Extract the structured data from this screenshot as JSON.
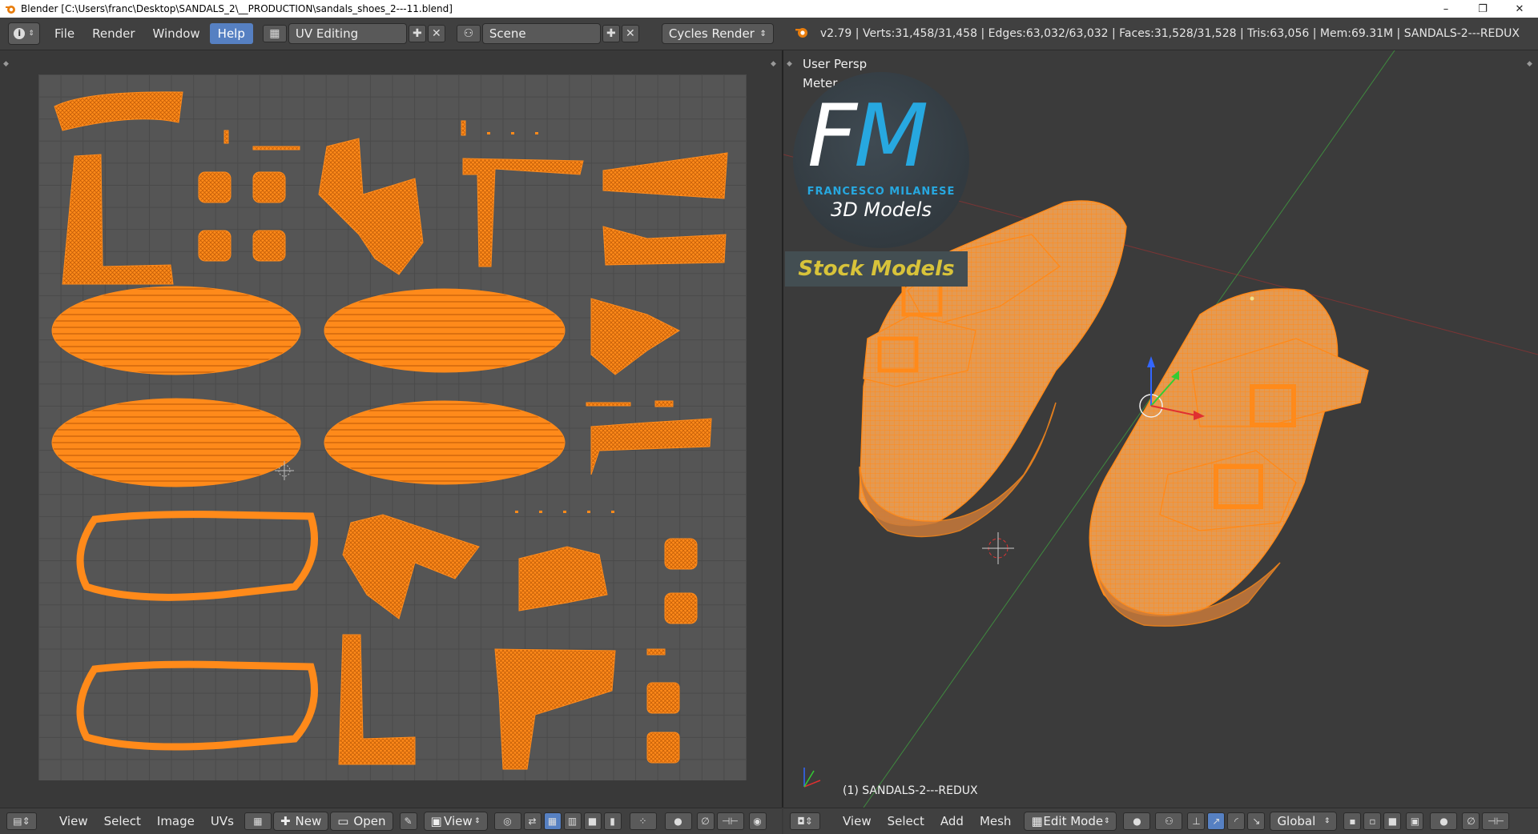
{
  "window": {
    "title": "Blender [C:\\Users\\franc\\Desktop\\SANDALS_2\\__PRODUCTION\\sandals_shoes_2---11.blend]",
    "minimize": "–",
    "maximize": "❐",
    "close": "✕"
  },
  "menu": {
    "items": [
      "File",
      "Render",
      "Window",
      "Help"
    ],
    "active": "Help"
  },
  "screen_layout": "UV Editing",
  "scene": "Scene",
  "render_engine": "Cycles Render",
  "stats": "v2.79 | Verts:31,458/31,458 | Edges:63,032/63,032 | Faces:31,528/31,528 | Tris:63,056 | Mem:69.31M | SANDALS-2---REDUX",
  "viewport": {
    "view_name": "User Persp",
    "units": "Meter",
    "object_label": "(1) SANDALS-2---REDUX"
  },
  "logo": {
    "initial_f": "F",
    "initial_m": "M",
    "byline": "FRANCESCO MILANESE",
    "subtitle": "3D Models",
    "banner": "Stock Models"
  },
  "uv_footer": {
    "view": "View",
    "select": "Select",
    "image": "Image",
    "uvs": "UVs",
    "new": "New",
    "open": "Open",
    "view2": "View"
  },
  "view3d_footer": {
    "view": "View",
    "select": "Select",
    "add": "Add",
    "mesh": "Mesh",
    "mode": "Edit Mode",
    "orientation": "Global"
  },
  "colors": {
    "wire": "#ff8a1a",
    "accent": "#5680c2",
    "logo_blue": "#27a8e0",
    "banner_text": "#d8c33a"
  }
}
